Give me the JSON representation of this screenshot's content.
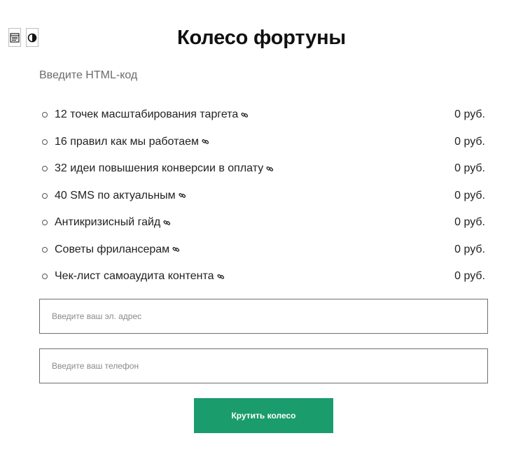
{
  "toolbar": {
    "form_icon": "form-icon",
    "contrast_icon": "contrast-icon"
  },
  "header": {
    "title": "Колесо фортуны"
  },
  "html_hint": "Введите HTML-код",
  "products": [
    {
      "name": "12 точек масштабирования таргета",
      "price": "0 руб."
    },
    {
      "name": "16 правил как мы работаем",
      "price": "0 руб."
    },
    {
      "name": "32 идеи повышения конверсии в оплату",
      "price": "0 руб."
    },
    {
      "name": "40 SMS по актуальным",
      "price": "0 руб."
    },
    {
      "name": "Антикризисный гайд",
      "price": "0 руб."
    },
    {
      "name": "Советы фрилансерам",
      "price": "0 руб."
    },
    {
      "name": "Чек-лист самоаудита контента",
      "price": "0 руб."
    }
  ],
  "form": {
    "email_placeholder": "Введите ваш эл. адрес",
    "phone_placeholder": "Введите ваш телефон",
    "submit_label": "Крутить колесо"
  },
  "colors": {
    "accent": "#1a9c6c"
  }
}
